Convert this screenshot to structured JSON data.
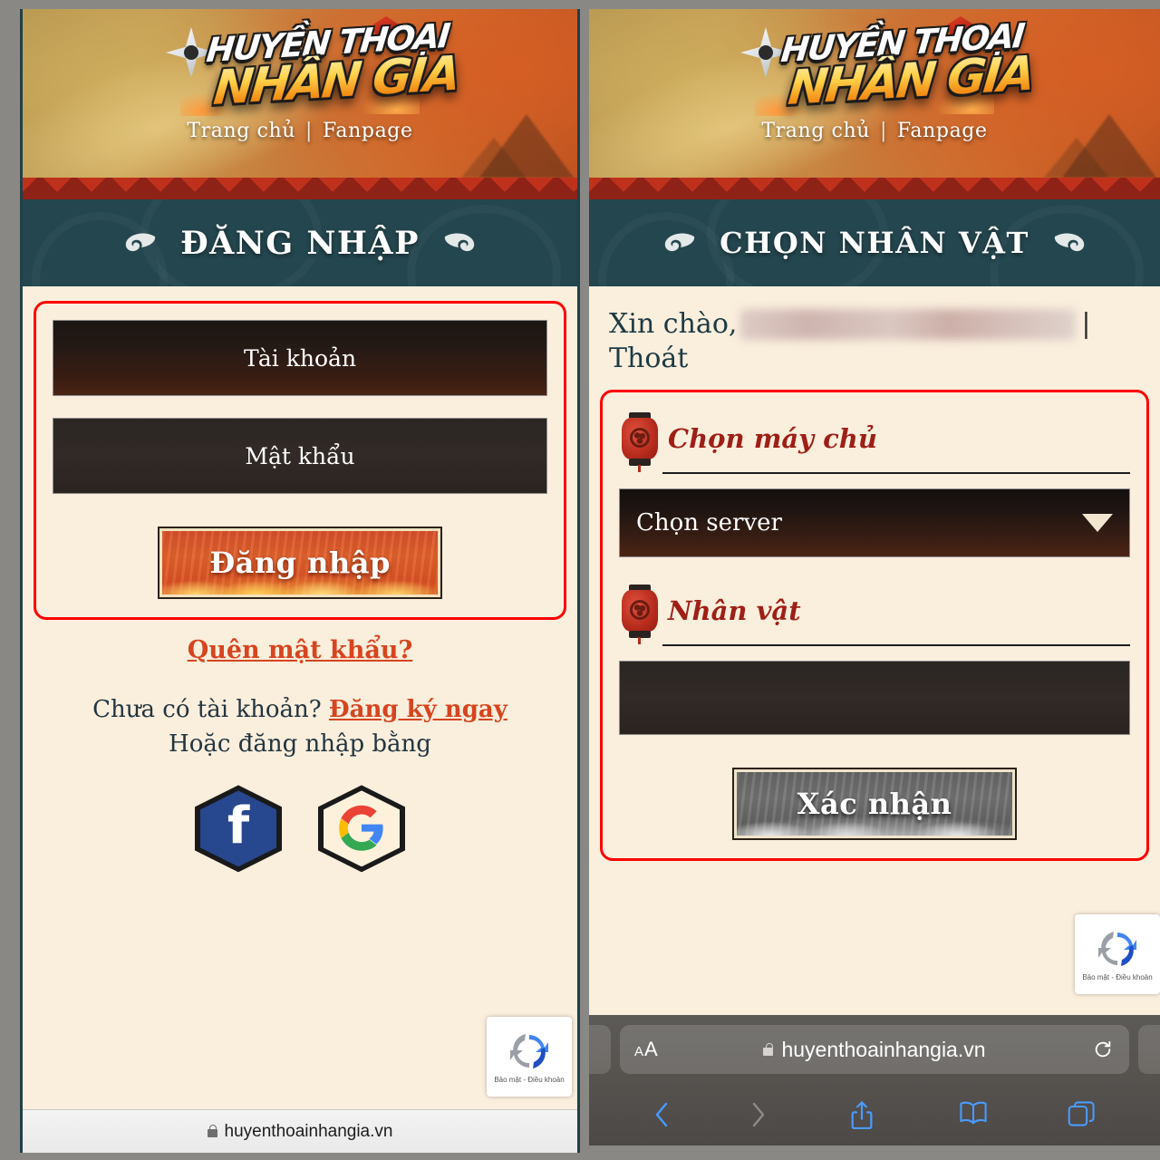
{
  "brand": {
    "logo_line1": "HUYỀN THOẠI",
    "logo_line2": "NHÂN GIA",
    "nav_home": "Trang chủ",
    "nav_separator": "|",
    "nav_fanpage": "Fanpage"
  },
  "left_panel": {
    "screen_title": "ĐĂNG NHẬP",
    "account_placeholder": "Tài khoản",
    "password_placeholder": "Mật khẩu",
    "login_button": "Đăng nhập",
    "forgot_password": "Quên mật khẩu?",
    "no_account_text": "Chưa có tài khoản?",
    "register_link": "Đăng ký ngay",
    "or_login_with": "Hoặc đăng nhập bằng",
    "facebook_glyph": "f",
    "recaptcha_text": "Bảo mật - Điều khoản",
    "url": "huyenthoainhangia.vn"
  },
  "right_panel": {
    "screen_title": "CHỌN NHÂN VẬT",
    "greeting": "Xin chào,",
    "account_masked": "",
    "separator": "|",
    "logout": "Thoát",
    "server_label": "Chọn máy chủ",
    "server_selected": "Chọn server",
    "character_label": "Nhân vật",
    "character_selected": "",
    "confirm_button": "Xác nhận",
    "recaptcha_text": "Bảo mật - Điều khoản"
  },
  "browser": {
    "text_size_small": "A",
    "text_size_big": "A",
    "url": "huyenthoainhangia.vn"
  },
  "colors": {
    "accent_red": "#d6451f",
    "highlight_box": "#ff0000",
    "banner_teal": "#24464e",
    "page_cream": "#faeedd",
    "lantern_red": "#b52a1c",
    "section_red": "#9e1f16",
    "safari_blue": "#4a9bff"
  }
}
